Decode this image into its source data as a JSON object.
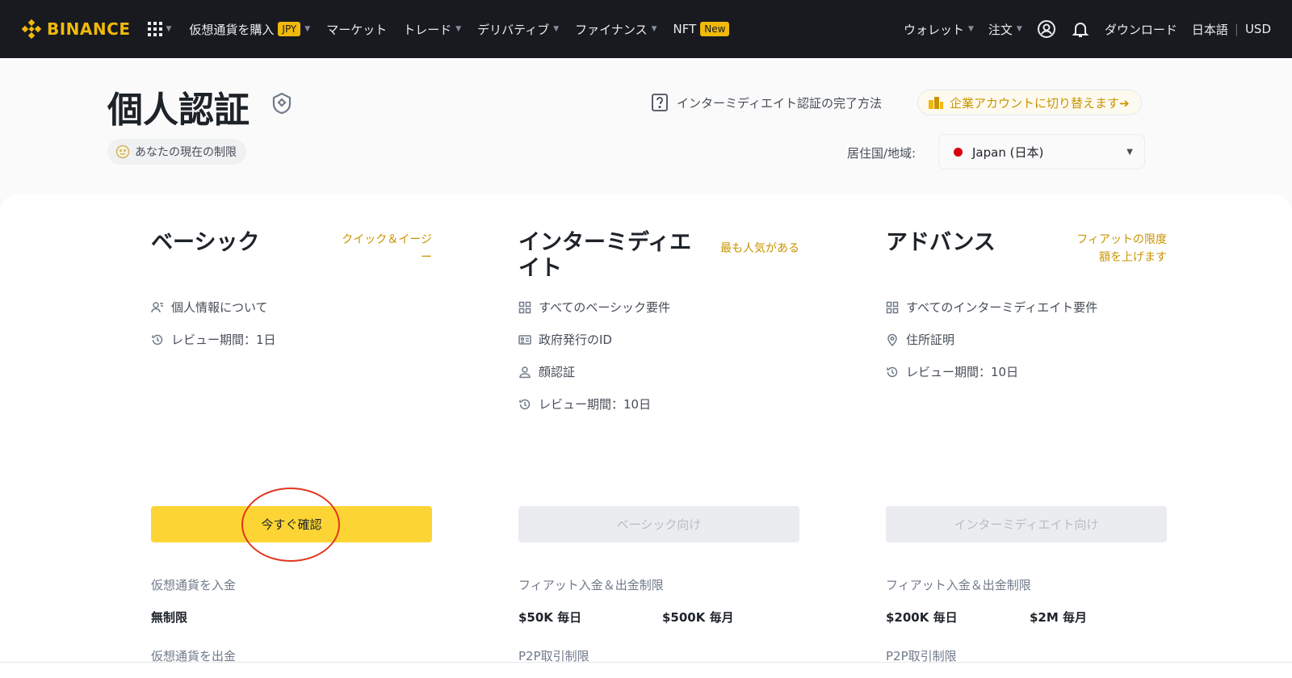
{
  "nav": {
    "logo": "BINANCE",
    "items": [
      {
        "label": "仮想通貨を購入",
        "badge": "JPY",
        "caret": true
      },
      {
        "label": "マーケット",
        "caret": false
      },
      {
        "label": "トレード",
        "caret": true
      },
      {
        "label": "デリバティブ",
        "caret": true
      },
      {
        "label": "ファイナンス",
        "caret": true
      },
      {
        "label": "NFT",
        "badge": "New",
        "caret": false
      }
    ],
    "right": {
      "wallet": "ウォレット",
      "orders": "注文",
      "download": "ダウンロード",
      "language": "日本語",
      "currency": "USD"
    },
    "icons": [
      "grid-icon",
      "user-circle-icon",
      "bell-icon"
    ]
  },
  "header": {
    "title": "個人認証",
    "limit_pill": "あなたの現在の制限",
    "help_link": "インターミディエイト認証の完了方法",
    "switch_account": "企業アカウントに切り替えます➔",
    "region_label": "居住国/地域:",
    "region_value": "Japan (日本)"
  },
  "tiers": [
    {
      "name": "ベーシック",
      "tag": "クイック＆イージー",
      "requirements": [
        {
          "icon": "person-info-icon",
          "text": "個人情報について"
        },
        {
          "icon": "clock-history-icon",
          "text": "レビュー期間：1日"
        }
      ],
      "button": "今すぐ確認",
      "limit_label": "仮想通貨を入金",
      "limit_values": [
        "無制限"
      ],
      "limit_label2": "仮想通貨を出金"
    },
    {
      "name": "インターミディエイト",
      "tag": "最も人気がある",
      "requirements": [
        {
          "icon": "grid-icon",
          "text": "すべてのベーシック要件"
        },
        {
          "icon": "id-card-icon",
          "text": "政府発行のID"
        },
        {
          "icon": "person-icon",
          "text": "顔認証"
        },
        {
          "icon": "clock-history-icon",
          "text": "レビュー期間：10日"
        }
      ],
      "button": "ベーシック向け",
      "limit_label": "フィアット入金＆出金制限",
      "limit_values": [
        "$50K 毎日",
        "$500K 毎月"
      ],
      "limit_label2": "P2P取引制限"
    },
    {
      "name": "アドバンス",
      "tag": "フィアットの限度額を上げます",
      "requirements": [
        {
          "icon": "grid-icon",
          "text": "すべてのインターミディエイト要件"
        },
        {
          "icon": "location-pin-icon",
          "text": "住所証明"
        },
        {
          "icon": "clock-history-icon",
          "text": "レビュー期間：10日"
        }
      ],
      "button": "インターミディエイト向け",
      "limit_label": "フィアット入金＆出金制限",
      "limit_values": [
        "$200K 毎日",
        "$2M 毎月"
      ],
      "limit_label2": "P2P取引制限"
    }
  ],
  "colors": {
    "brand": "#f0b90b",
    "nav_bg": "#181a20",
    "primary_button": "#fcd535",
    "highlight_circle": "#e0361e"
  }
}
